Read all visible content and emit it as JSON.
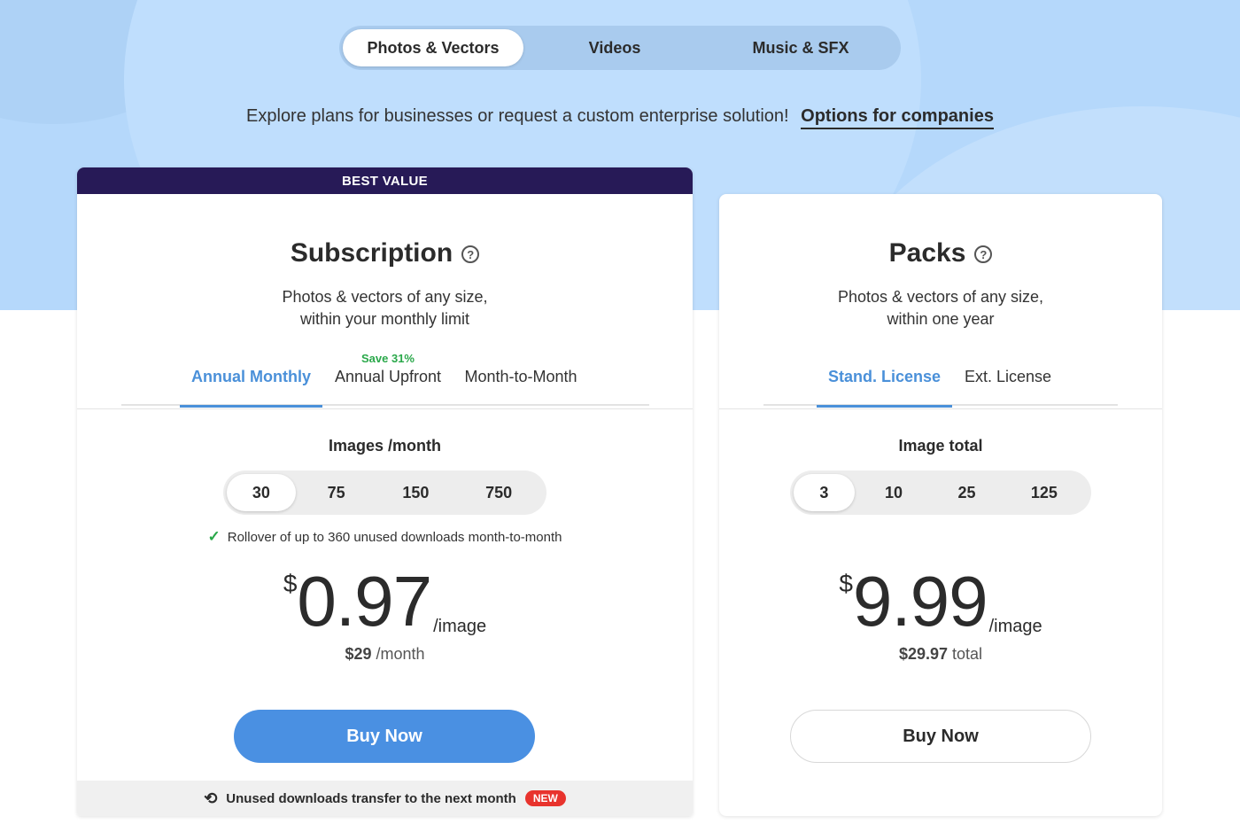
{
  "media_tabs": [
    {
      "label": "Photos & Vectors",
      "active": true
    },
    {
      "label": "Videos",
      "active": false
    },
    {
      "label": "Music & SFX",
      "active": false
    }
  ],
  "explore": {
    "text": "Explore plans for businesses or request a custom enterprise solution!",
    "link": "Options for companies"
  },
  "subscription": {
    "badge": "BEST VALUE",
    "title": "Subscription",
    "desc_line1": "Photos & vectors of any size,",
    "desc_line2": "within your monthly limit",
    "terms": [
      {
        "label": "Annual Monthly",
        "active": true
      },
      {
        "label": "Annual Upfront",
        "active": false,
        "badge": "Save 31%"
      },
      {
        "label": "Month-to-Month",
        "active": false
      }
    ],
    "qty_label": "Images /month",
    "quantities": [
      "30",
      "75",
      "150",
      "750"
    ],
    "selected_qty": "30",
    "rollover": "Rollover of up to 360 unused downloads month-to-month",
    "currency": "$",
    "price": "0.97",
    "unit": "/image",
    "total_amount": "$29",
    "total_suffix": "/month",
    "buy_label": "Buy Now",
    "footer_text": "Unused downloads transfer to the next month",
    "footer_badge": "NEW"
  },
  "packs": {
    "title": "Packs",
    "desc_line1": "Photos & vectors of any size,",
    "desc_line2": "within one year",
    "terms": [
      {
        "label": "Stand. License",
        "active": true
      },
      {
        "label": "Ext. License",
        "active": false
      }
    ],
    "qty_label": "Image total",
    "quantities": [
      "3",
      "10",
      "25",
      "125"
    ],
    "selected_qty": "3",
    "currency": "$",
    "price": "9.99",
    "unit": "/image",
    "total_amount": "$29.97",
    "total_suffix": "total",
    "buy_label": "Buy Now"
  },
  "colors": {
    "accent": "#4a90e2",
    "hero_bg": "#b5d8fb",
    "badge_bg": "#271a57",
    "save_green": "#2aa84a",
    "new_red": "#e8332d"
  }
}
